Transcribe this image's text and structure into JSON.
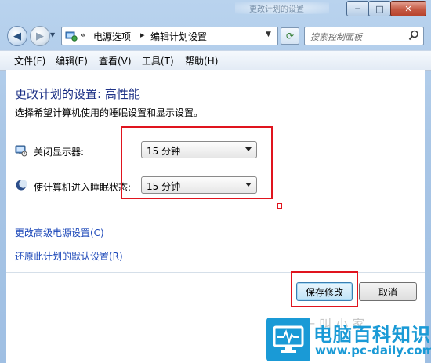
{
  "window": {
    "title_faint": "更改计划的设置",
    "buttons": {
      "minimize": "─",
      "maximize": "□",
      "close": "✕"
    }
  },
  "nav": {
    "back_icon": "back-arrow-icon",
    "forward_icon": "forward-arrow-icon",
    "breadcrumb": [
      "电源选项",
      "编辑计划设置"
    ],
    "search_placeholder": "搜索控制面板"
  },
  "menu": [
    "文件(F)",
    "编辑(E)",
    "查看(V)",
    "工具(T)",
    "帮助(H)"
  ],
  "main": {
    "title": "更改计划的设置: 高性能",
    "description": "选择希望计算机使用的睡眠设置和显示设置。",
    "settings": [
      {
        "label": "关闭显示器:",
        "value": "15 分钟",
        "icon": "monitor-icon"
      },
      {
        "label": "使计算机进入睡眠状态:",
        "value": "15 分钟",
        "icon": "moon-sleep-icon"
      }
    ],
    "links": [
      "更改高级电源设置(C)",
      "还原此计划的默认设置(R)"
    ],
    "buttons": {
      "save": "保存修改",
      "cancel": "取消"
    }
  },
  "watermark": {
    "title": "电脑百科知识",
    "url": "www.pc-daily.com",
    "faint_text": "一 叫 小 家"
  },
  "colors": {
    "highlight": "#e0141e",
    "title_blue": "#1e3287",
    "link_blue": "#1a46b8",
    "logo_blue": "#1a9ad6"
  }
}
